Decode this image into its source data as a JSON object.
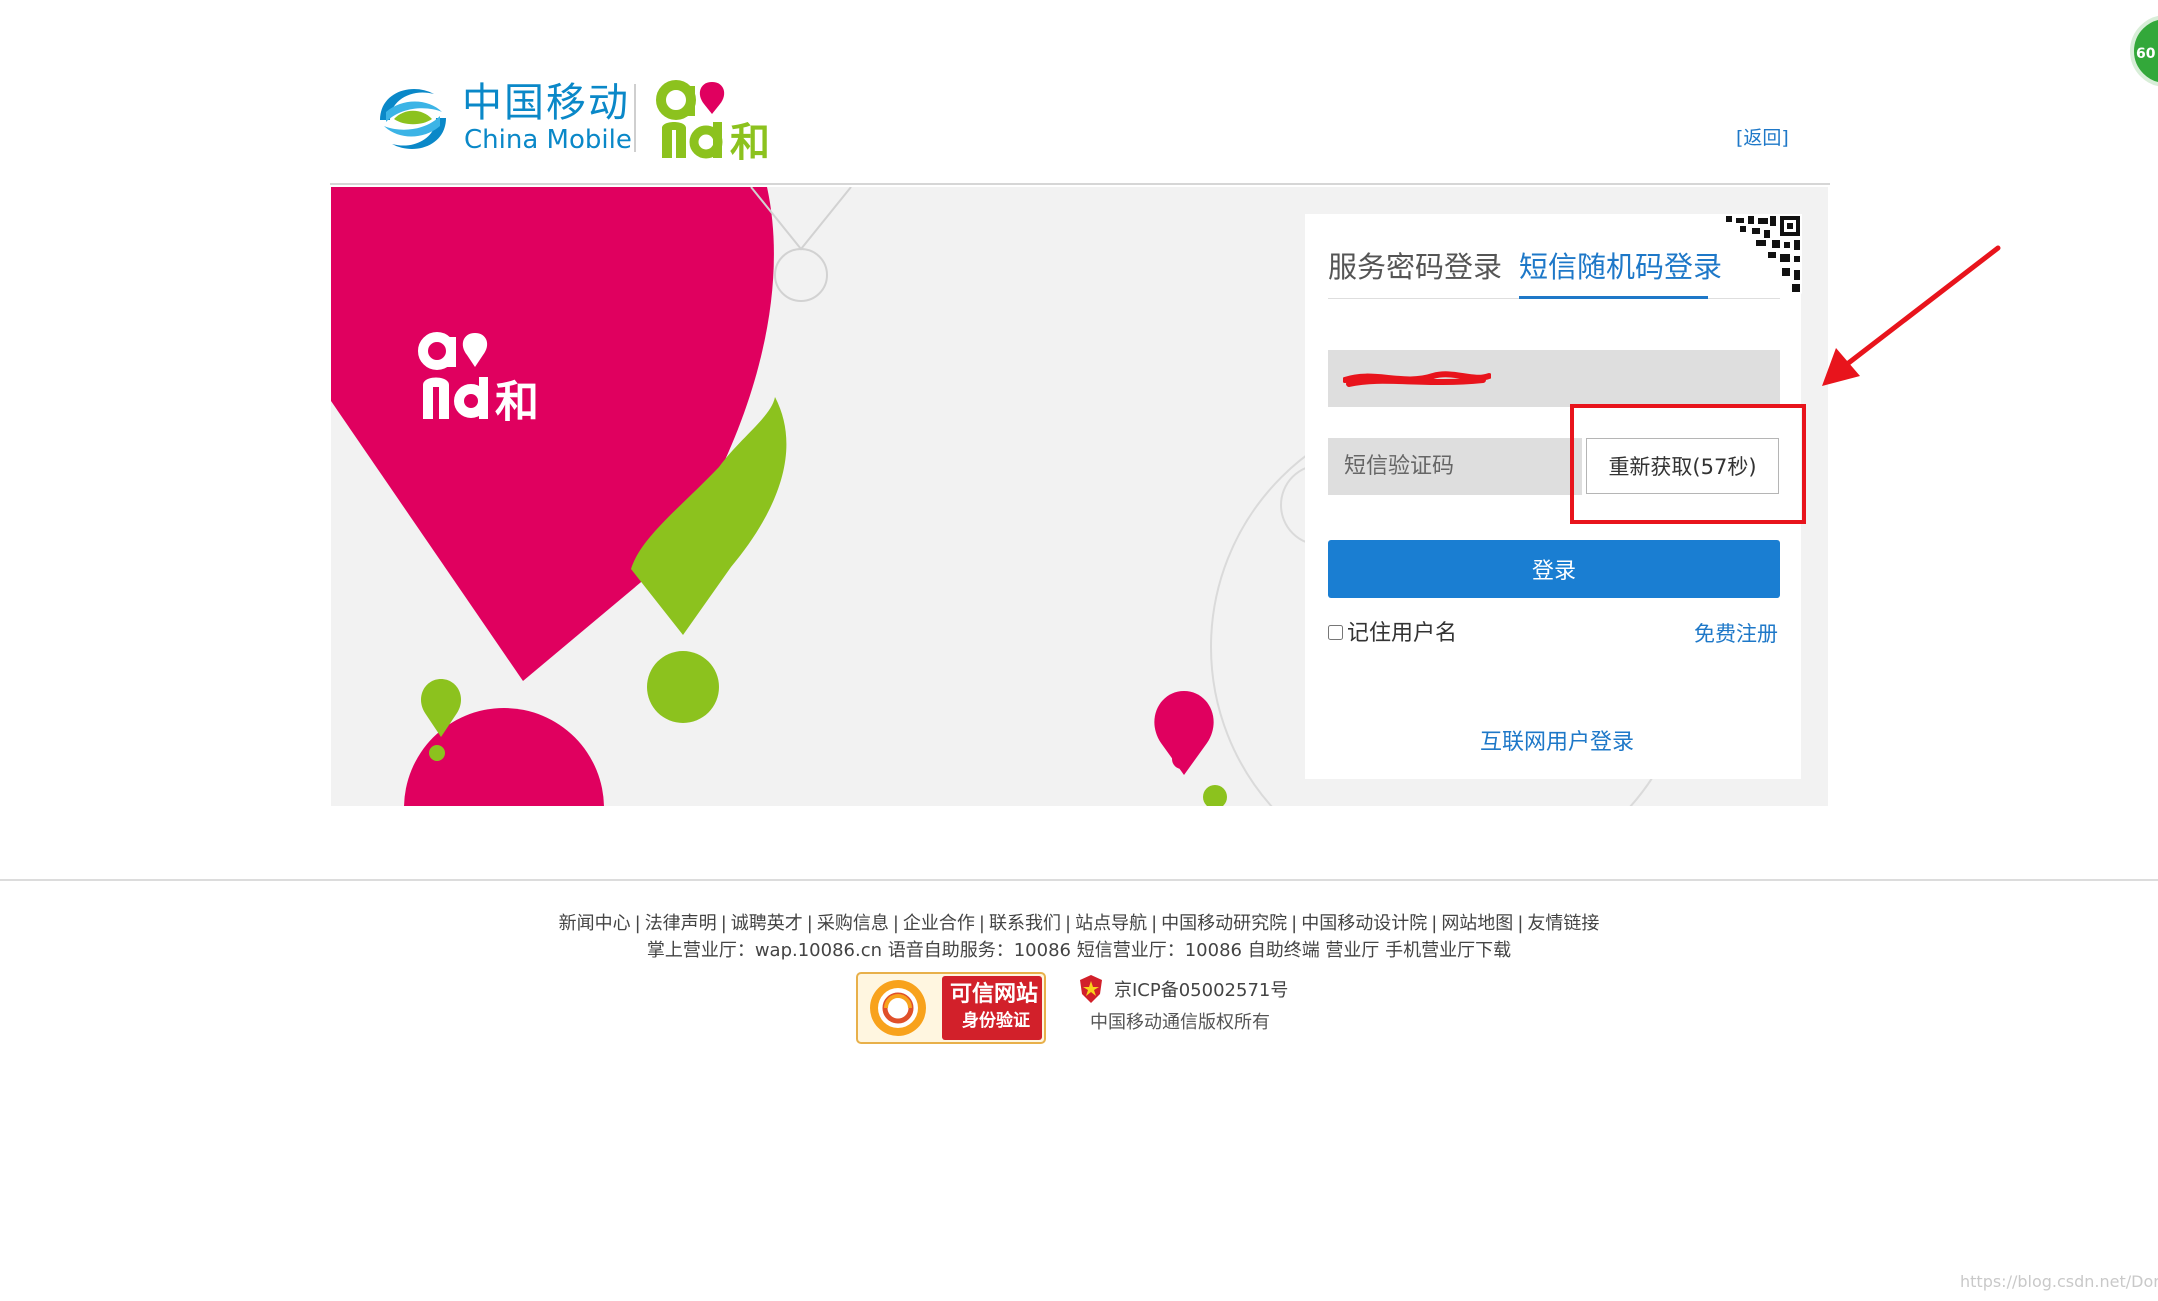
{
  "header": {
    "brand_cn": "中国移动",
    "brand_en": "China Mobile",
    "back_link": "[返回]"
  },
  "login": {
    "tab_password": "服务密码登录",
    "tab_sms": "短信随机码登录",
    "code_placeholder": "短信验证码",
    "resend_button": "重新获取(57秒)",
    "login_button": "登录",
    "remember_label": "记住用户名",
    "register_link": "免费注册",
    "internet_login": "互联网用户登录"
  },
  "footer": {
    "links": [
      "新闻中心",
      "法律声明",
      "诚聘英才",
      "采购信息",
      "企业合作",
      "联系我们",
      "站点导航",
      "中国移动研究院",
      "中国移动设计院",
      "网站地图",
      "友情链接"
    ],
    "services": "掌上营业厅：wap.10086.cn 语音自助服务：10086 短信营业厅：10086 自助终端 营业厅 手机营业厅下载",
    "trust_line1": "可信网站",
    "trust_line2": "身份验证",
    "icp": "京ICP备05002571号",
    "copyright": "中国移动通信版权所有"
  },
  "overlay": {
    "badge_text": "60",
    "watermark": "https://blog.csdn.net/Dontla"
  },
  "colors": {
    "magenta": "#e0005f",
    "green": "#8cc21e",
    "link_blue": "#1e78c8",
    "button_blue": "#1a7ed2",
    "annotation_red": "#e8141c"
  },
  "icons": [
    "china-mobile-logo",
    "and-logo",
    "qr-code-icon",
    "police-badge-icon",
    "trust-site-badge",
    "annotation-arrow"
  ]
}
